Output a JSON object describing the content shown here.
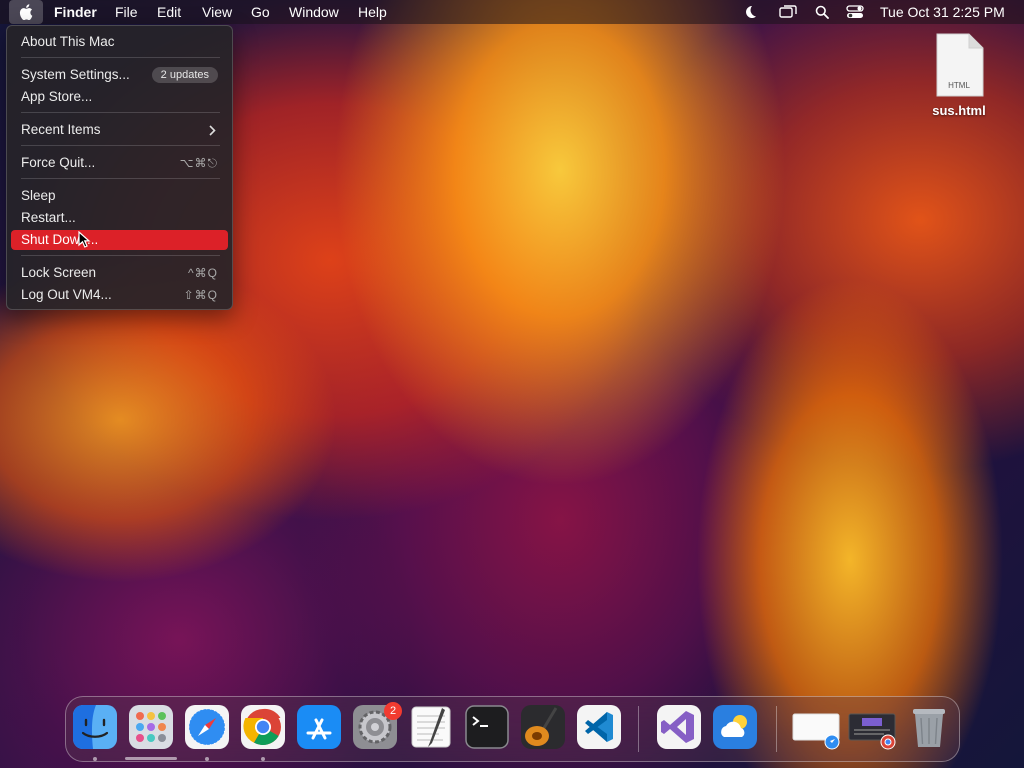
{
  "menubar": {
    "app_name": "Finder",
    "items": [
      "File",
      "Edit",
      "View",
      "Go",
      "Window",
      "Help"
    ],
    "clock": "Tue Oct 31  2:25 PM",
    "status_icons": [
      "moon-icon",
      "screen-mirroring-icon",
      "search-icon",
      "control-center-icon"
    ]
  },
  "apple_menu": {
    "about": "About This Mac",
    "system_settings": "System Settings...",
    "updates_badge": "2 updates",
    "app_store": "App Store...",
    "recent_items": "Recent Items",
    "force_quit": "Force Quit...",
    "force_quit_shortcut": "⌥⌘⎋",
    "sleep": "Sleep",
    "restart": "Restart...",
    "shut_down": "Shut Down...",
    "lock_screen": "Lock Screen",
    "lock_screen_shortcut": "^⌘Q",
    "log_out": "Log Out VM4...",
    "log_out_shortcut": "⇧⌘Q",
    "highlight_color": "#dc2128"
  },
  "desktop": {
    "file_name": "sus.html",
    "file_type": "HTML"
  },
  "dock": {
    "apps": [
      "finder-icon",
      "launchpad-icon",
      "safari-icon",
      "chrome-icon",
      "app-store-icon",
      "system-settings-icon",
      "textedit-icon",
      "terminal-icon",
      "garageband-icon",
      "vscode-icon",
      "visual-studio-icon",
      "weather-icon",
      "safari-window-icon",
      "chrome-window-icon",
      "trash-icon"
    ],
    "system_settings_badge": "2"
  }
}
